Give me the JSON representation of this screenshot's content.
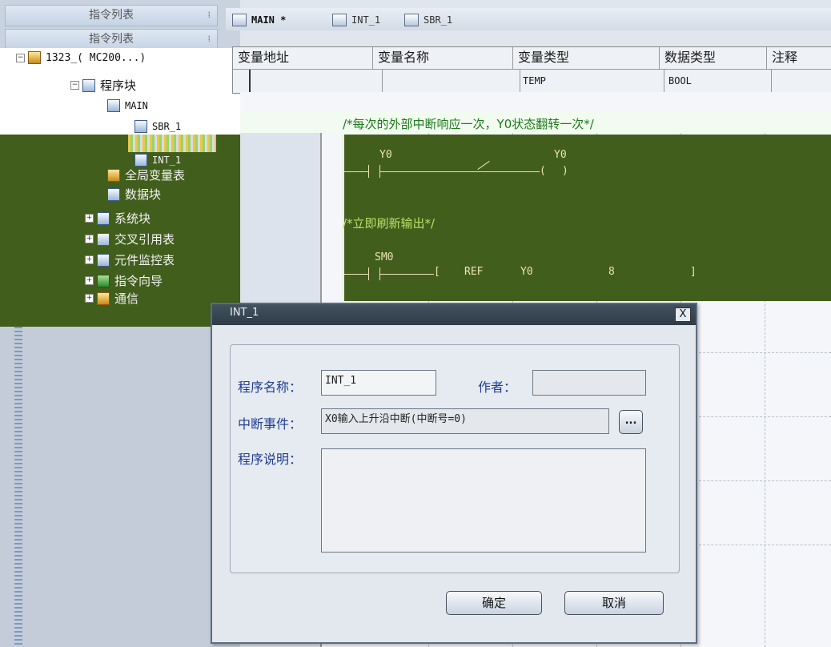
{
  "left_panel": {
    "header1": "指令列表",
    "header2": "指令列表",
    "project": "1323_( MC200...)",
    "tree": [
      {
        "label": "程序块"
      },
      {
        "label": "MAIN"
      },
      {
        "label": "SBR_1"
      },
      {
        "label": "INT_1"
      },
      {
        "label": "全局变量表"
      },
      {
        "label": "数据块"
      },
      {
        "label": "系统块"
      },
      {
        "label": "交叉引用表"
      },
      {
        "label": "元件监控表"
      },
      {
        "label": "指令向导"
      },
      {
        "label": "通信"
      }
    ]
  },
  "tabs": [
    {
      "label": "MAIN *"
    },
    {
      "label": "INT_1"
    },
    {
      "label": "SBR_1"
    }
  ],
  "var_table": {
    "headers": [
      "变量地址",
      "变量名称",
      "变量类型",
      "数据类型",
      "注释"
    ],
    "row": [
      "",
      "",
      "TEMP",
      "BOOL",
      ""
    ]
  },
  "ladder": {
    "comment1": "/*每次的外部中断响应一次，Y0状态翻转一次*/",
    "contact1": "Y0",
    "coil1": "Y0",
    "comment2": "/*立即刷新输出*/",
    "contact2": "SM0",
    "instr": "REF",
    "op1": "Y0",
    "op2": "8",
    "bracket_open": "[",
    "bracket_close": "]"
  },
  "dialog": {
    "title": "INT_1",
    "close": "X",
    "label_name": "程序名称：",
    "value_name": "INT_1",
    "label_author": "作者：",
    "value_author": "",
    "label_event": "中断事件：",
    "value_event": "X0输入上升沿中断(中断号=0)",
    "dots": "...",
    "label_desc": "程序说明：",
    "value_desc": "",
    "ok": "确定",
    "cancel": "取消"
  }
}
